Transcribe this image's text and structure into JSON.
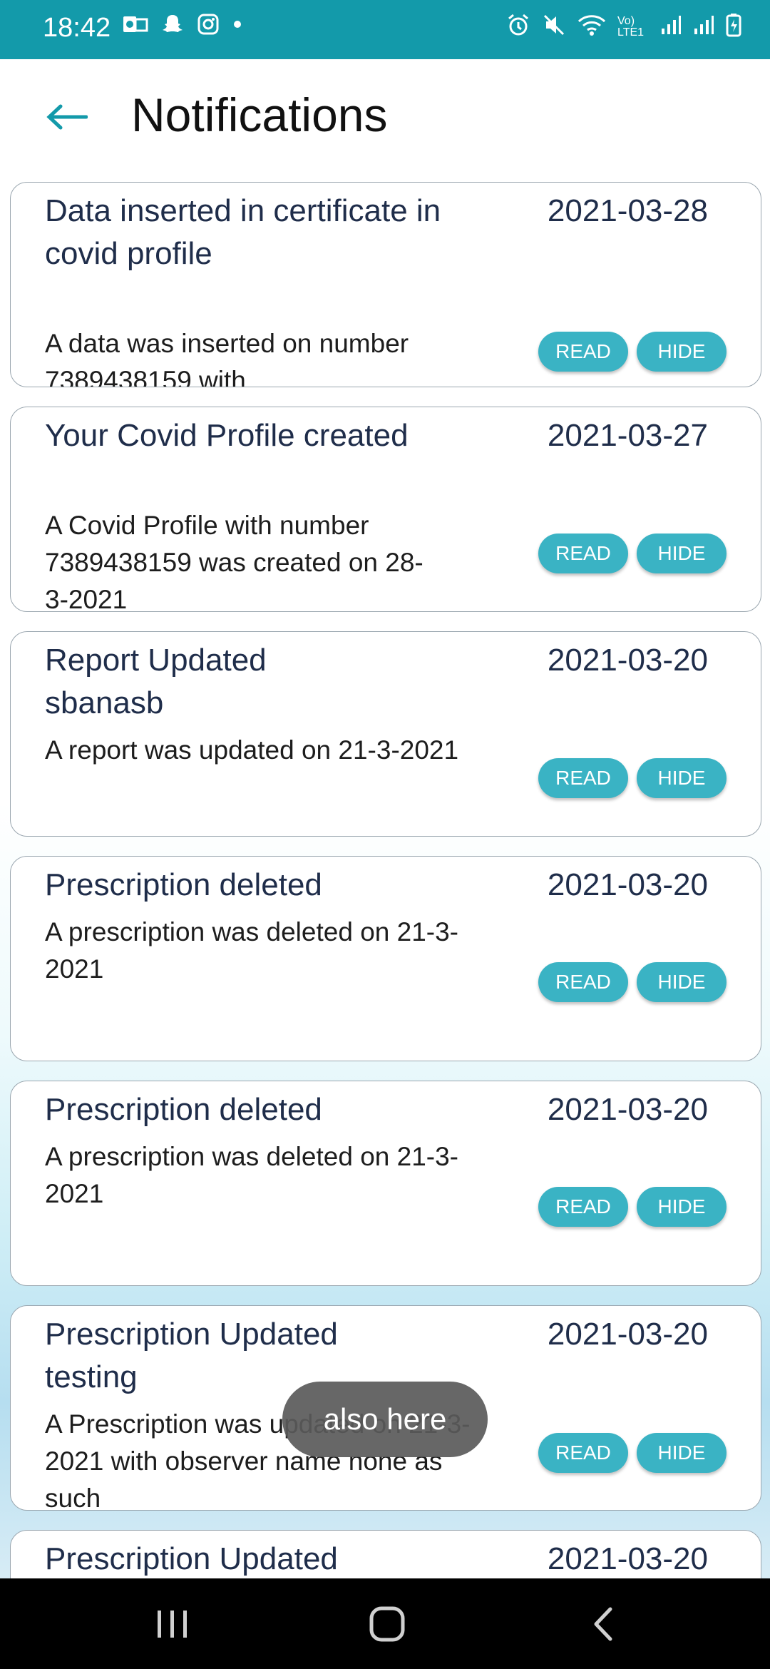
{
  "status_bar": {
    "time": "18:42",
    "network_label": "Vo) LTE1"
  },
  "header": {
    "title": "Notifications"
  },
  "buttons": {
    "read": "READ",
    "hide": "HIDE"
  },
  "notifications": [
    {
      "title": "Data inserted in certificate in covid profile",
      "date": "2021-03-28",
      "body": "A data was inserted on number 7389438159 with"
    },
    {
      "title": "Your Covid Profile created",
      "date": "2021-03-27",
      "body": "A Covid Profile with number 7389438159 was created on 28-3-2021"
    },
    {
      "title": "Report Updated sbanasb",
      "date": "2021-03-20",
      "body": "A report was updated on 21-3-2021"
    },
    {
      "title": "Prescription deleted",
      "date": "2021-03-20",
      "body": "A prescription was deleted on 21-3-2021"
    },
    {
      "title": "Prescription deleted",
      "date": "2021-03-20",
      "body": "A prescription was deleted on 21-3-2021"
    },
    {
      "title": "Prescription Updated testing",
      "date": "2021-03-20",
      "body": "A Prescription was updated on 21-3-2021 with observer name none as such"
    },
    {
      "title": "Prescription Updated",
      "date": "2021-03-20",
      "body": ""
    }
  ],
  "toast": {
    "text": "also here"
  },
  "colors": {
    "status_bar": "#139aaa",
    "accent": "#3ab3c4",
    "title_text": "#1f2d4a"
  }
}
